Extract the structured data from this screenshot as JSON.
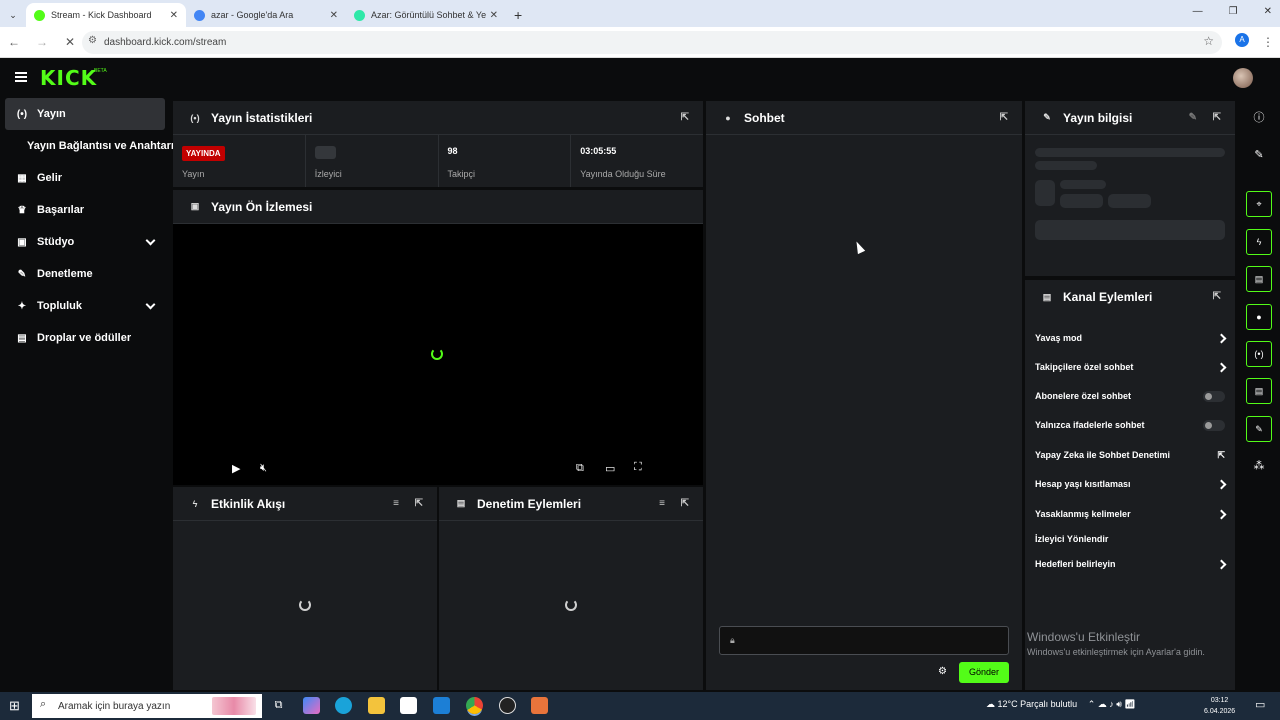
{
  "browser": {
    "tabs": [
      {
        "title": "Stream - Kick Dashboard",
        "color": "#53fc18",
        "active": true
      },
      {
        "title": "azar - Google'da Ara",
        "color": "#4285f4",
        "active": false
      },
      {
        "title": "Azar: Görüntülü Sohbet & Yeni",
        "color": "#2ee8a8",
        "active": false
      }
    ],
    "new_tab": "+",
    "url": "dashboard.kick.com/stream",
    "profile_initial": "A"
  },
  "app": {
    "logo": "KICK",
    "beta": "BETA"
  },
  "sidebar": {
    "items": [
      {
        "label": "Yayın",
        "icon": "broadcast-icon",
        "glyph": "(•)"
      },
      {
        "label": "Yayın Bağlantısı ve Anahtarı",
        "icon": "",
        "glyph": ""
      },
      {
        "label": "Gelir",
        "icon": "chart-icon",
        "glyph": "▦"
      },
      {
        "label": "Başarılar",
        "icon": "trophy-icon",
        "glyph": "♛"
      },
      {
        "label": "Stüdyo",
        "icon": "studio-icon",
        "glyph": "▣"
      },
      {
        "label": "Denetleme",
        "icon": "wrench-icon",
        "glyph": "✎"
      },
      {
        "label": "Topluluk",
        "icon": "community-icon",
        "glyph": "✦"
      },
      {
        "label": "Droplar ve ödüller",
        "icon": "drops-icon",
        "glyph": "▤"
      }
    ]
  },
  "stats": {
    "title": "Yayın İstatistikleri",
    "live_badge": "YAYINDA",
    "live_label": "Yayın",
    "viewers_label": "İzleyici",
    "followers_value": "98",
    "followers_label": "Takipçi",
    "duration_value": "03:05:55",
    "duration_label": "Yayında Olduğu Süre"
  },
  "preview": {
    "title": "Yayın Ön İzlemesi"
  },
  "activity": {
    "title": "Etkinlik Akışı"
  },
  "moderation": {
    "title": "Denetim Eylemleri"
  },
  "chat": {
    "title": "Sohbet",
    "send_label": "Gönder"
  },
  "info": {
    "title": "Yayın bilgisi"
  },
  "channel_actions": {
    "title": "Kanal Eylemleri",
    "items": [
      {
        "label": "Yavaş mod",
        "control": "arrow"
      },
      {
        "label": "Takipçilere özel sohbet",
        "control": "arrow"
      },
      {
        "label": "Abonelere özel sohbet",
        "control": "toggle"
      },
      {
        "label": "Yalnızca ifadelerle sohbet",
        "control": "toggle"
      },
      {
        "label": "Yapay Zeka ile Sohbet Denetimi",
        "control": "external"
      },
      {
        "label": "Hesap yaşı kısıtlaması",
        "control": "arrow"
      },
      {
        "label": "Yasaklanmış kelimeler",
        "control": "arrow"
      },
      {
        "label": "İzleyici Yönlendir",
        "control": "none"
      },
      {
        "label": "Hedefleri belirleyin",
        "control": "arrow"
      }
    ]
  },
  "windows": {
    "watermark_title": "Windows'u Etkinleştir",
    "watermark_sub": "Windows'u etkinleştirmek için Ayarlar'a gidin.",
    "search_placeholder": "Aramak için buraya yazın",
    "weather": "12°C  Parçalı bulutlu",
    "time": "03:12",
    "date": "6.04.2026"
  },
  "colors": {
    "accent": "#53fc18",
    "live": "#c20000",
    "panel": "#1b1d20"
  }
}
